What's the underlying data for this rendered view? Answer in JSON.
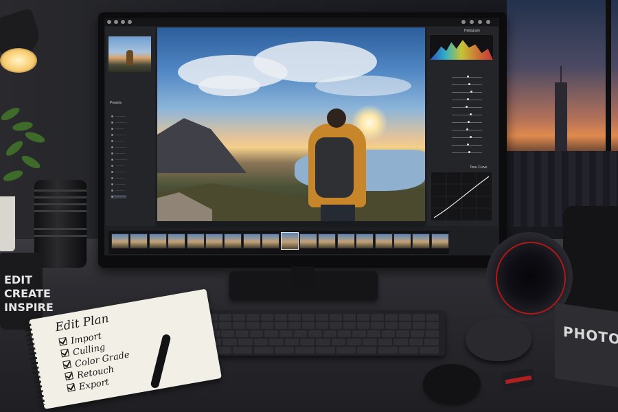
{
  "mug": {
    "lines": [
      "EDIT",
      "CREATE",
      "INSPIRE"
    ]
  },
  "notebook": {
    "title": "Edit Plan",
    "items": [
      "Import",
      "Culling",
      "Color Grade",
      "Retouch",
      "Export"
    ]
  },
  "book": {
    "text": "PHOTOGR"
  },
  "monitor": {
    "left_panel": {
      "presets_header": "Presets"
    },
    "right_panel": {
      "histogram_label": "Histogram",
      "tone_curve_label": "Tone Curve"
    }
  },
  "colors": {
    "jacket": "#c8862a",
    "sky": "#4f86c3",
    "sunset": "#e08a4e",
    "lens_ring": "#b01818"
  }
}
